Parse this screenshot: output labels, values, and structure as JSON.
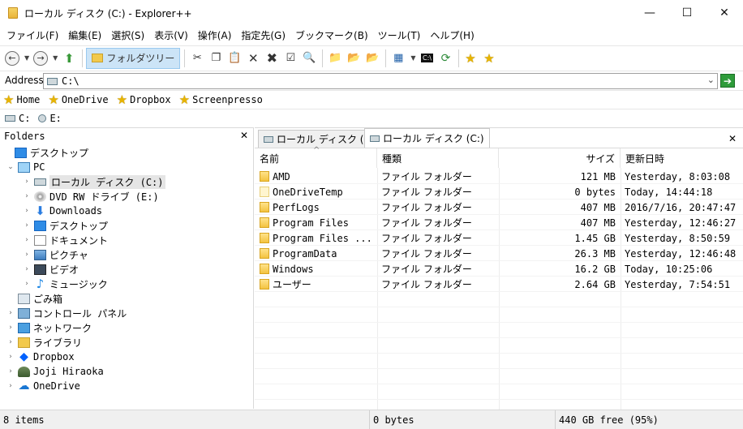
{
  "window": {
    "title": "ローカル ディスク (C:) - Explorer++",
    "controls": {
      "minimize": "—",
      "maximize": "☐",
      "close": "✕"
    }
  },
  "menu": [
    "ファイル(F)",
    "編集(E)",
    "選択(S)",
    "表示(V)",
    "操作(A)",
    "指定先(G)",
    "ブックマーク(B)",
    "ツール(T)",
    "ヘルプ(H)"
  ],
  "toolbar": {
    "folders_label": "フォルダツリー"
  },
  "address": {
    "label": "Address",
    "value": "C:\\"
  },
  "bookmarks": [
    "Home",
    "OneDrive",
    "Dropbox",
    "Screenpresso"
  ],
  "drives": [
    "C:",
    "E:"
  ],
  "folders_pane": {
    "title": "Folders",
    "items": [
      {
        "label": "デスクトップ",
        "icon": "desktop-icon",
        "level": 0,
        "expander": ""
      },
      {
        "label": "PC",
        "icon": "pc-icon",
        "level": 1,
        "expander": "⌄"
      },
      {
        "label": "ローカル ディスク (C:)",
        "icon": "drive-icon",
        "level": 2,
        "expander": "›",
        "selected": true
      },
      {
        "label": "DVD RW ドライブ (E:)",
        "icon": "dvd-icon",
        "level": 2,
        "expander": "›"
      },
      {
        "label": "Downloads",
        "icon": "downloads-icon",
        "level": 2,
        "expander": "›"
      },
      {
        "label": "デスクトップ",
        "icon": "desktop-icon",
        "level": 2,
        "expander": "›"
      },
      {
        "label": "ドキュメント",
        "icon": "documents-icon",
        "level": 2,
        "expander": "›"
      },
      {
        "label": "ピクチャ",
        "icon": "pictures-icon",
        "level": 2,
        "expander": "›"
      },
      {
        "label": "ビデオ",
        "icon": "videos-icon",
        "level": 2,
        "expander": "›"
      },
      {
        "label": "ミュージック",
        "icon": "music-icon",
        "level": 2,
        "expander": "›"
      },
      {
        "label": "ごみ箱",
        "icon": "recycle-bin-icon",
        "level": 1,
        "expander": ""
      },
      {
        "label": "コントロール パネル",
        "icon": "control-panel-icon",
        "level": 1,
        "expander": "›"
      },
      {
        "label": "ネットワーク",
        "icon": "network-icon",
        "level": 1,
        "expander": "›"
      },
      {
        "label": "ライブラリ",
        "icon": "library-icon",
        "level": 1,
        "expander": "›"
      },
      {
        "label": "Dropbox",
        "icon": "dropbox-icon",
        "level": 1,
        "expander": "›"
      },
      {
        "label": "Joji Hiraoka",
        "icon": "user-icon",
        "level": 1,
        "expander": "›"
      },
      {
        "label": "OneDrive",
        "icon": "onedrive-icon",
        "level": 1,
        "expander": "›"
      }
    ]
  },
  "tabs": [
    "ローカル ディスク (C:)",
    "ローカル ディスク (C:)"
  ],
  "file_list": {
    "columns": [
      "名前",
      "種類",
      "サイズ",
      "更新日時"
    ],
    "rows": [
      {
        "name": "AMD",
        "type": "ファイル フォルダー",
        "size": "121 MB",
        "date": "Yesterday, 8:03:08"
      },
      {
        "name": "OneDriveTemp",
        "type": "ファイル フォルダー",
        "size": "0 bytes",
        "date": "Today, 14:44:18"
      },
      {
        "name": "PerfLogs",
        "type": "ファイル フォルダー",
        "size": "407 MB",
        "date": "2016/7/16, 20:47:47"
      },
      {
        "name": "Program Files",
        "type": "ファイル フォルダー",
        "size": "407 MB",
        "date": "Yesterday, 12:46:27"
      },
      {
        "name": "Program Files ...",
        "type": "ファイル フォルダー",
        "size": "1.45 GB",
        "date": "Yesterday, 8:50:59"
      },
      {
        "name": "ProgramData",
        "type": "ファイル フォルダー",
        "size": "26.3 MB",
        "date": "Yesterday, 12:46:48"
      },
      {
        "name": "Windows",
        "type": "ファイル フォルダー",
        "size": "16.2 GB",
        "date": "Today, 10:25:06"
      },
      {
        "name": "ユーザー",
        "type": "ファイル フォルダー",
        "size": "2.64 GB",
        "date": "Yesterday, 7:54:51"
      }
    ]
  },
  "status": {
    "items": "8 items",
    "selected_size": "0 bytes",
    "free": "440 GB free (95%)"
  }
}
